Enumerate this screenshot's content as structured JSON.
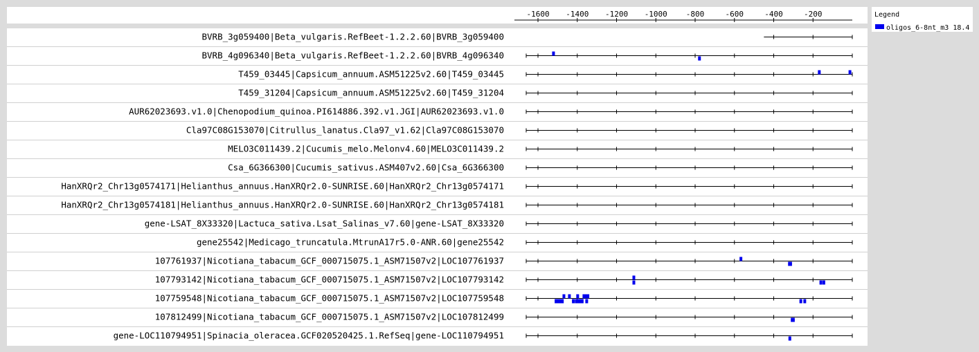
{
  "chart_data": {
    "type": "scatter",
    "xlim": [
      -1660,
      0
    ],
    "x_ticks": [
      -1600,
      -1400,
      -1200,
      -1000,
      -800,
      -600,
      -400,
      -200
    ],
    "legend": {
      "title": "Legend",
      "entries": [
        {
          "label": "oligos_6-8nt_m3 18.4",
          "color": "#0000ee"
        }
      ]
    },
    "rows": [
      {
        "label": "BVRB_3g059400|Beta_vulgaris.RefBeet-1.2.2.60|BVRB_3g059400",
        "start": -450,
        "marks": []
      },
      {
        "label": "BVRB_4g096340|Beta_vulgaris.RefBeet-1.2.2.60|BVRB_4g096340",
        "start": -1660,
        "marks": [
          {
            "x": -1521,
            "strand": "+"
          },
          {
            "x": -778,
            "strand": "-"
          }
        ]
      },
      {
        "label": "T459_03445|Capsicum_annuum.ASM51225v2.60|T459_03445",
        "start": -1660,
        "marks": [
          {
            "x": -168,
            "strand": "+"
          },
          {
            "x": -12,
            "strand": "+"
          }
        ]
      },
      {
        "label": "T459_31204|Capsicum_annuum.ASM51225v2.60|T459_31204",
        "start": -1660,
        "marks": []
      },
      {
        "label": "AUR62023693.v1.0|Chenopodium_quinoa.PI614886.392.v1.JGI|AUR62023693.v1.0",
        "start": -1660,
        "marks": []
      },
      {
        "label": "Cla97C08G153070|Citrullus_lanatus.Cla97_v1.62|Cla97C08G153070",
        "start": -1660,
        "marks": []
      },
      {
        "label": "MELO3C011439.2|Cucumis_melo.Melonv4.60|MELO3C011439.2",
        "start": -1660,
        "marks": []
      },
      {
        "label": "Csa_6G366300|Cucumis_sativus.ASM407v2.60|Csa_6G366300",
        "start": -1660,
        "marks": []
      },
      {
        "label": "HanXRQr2_Chr13g0574171|Helianthus_annuus.HanXRQr2.0-SUNRISE.60|HanXRQr2_Chr13g0574171",
        "start": -1660,
        "marks": []
      },
      {
        "label": "HanXRQr2_Chr13g0574181|Helianthus_annuus.HanXRQr2.0-SUNRISE.60|HanXRQr2_Chr13g0574181",
        "start": -1660,
        "marks": []
      },
      {
        "label": "gene-LSAT_8X33320|Lactuca_sativa.Lsat_Salinas_v7.60|gene-LSAT_8X33320",
        "start": -1660,
        "marks": []
      },
      {
        "label": "gene25542|Medicago_truncatula.MtrunA17r5.0-ANR.60|gene25542",
        "start": -1660,
        "marks": []
      },
      {
        "label": "107761937|Nicotiana_tabacum_GCF_000715075.1_ASM71507v2|LOC107761937",
        "start": -1660,
        "marks": [
          {
            "x": -567,
            "strand": "+"
          },
          {
            "x": -320,
            "strand": "-"
          },
          {
            "x": -314,
            "strand": "-"
          }
        ]
      },
      {
        "label": "107793142|Nicotiana_tabacum_GCF_000715075.1_ASM71507v2|LOC107793142",
        "start": -1660,
        "marks": [
          {
            "x": -1112,
            "strand": "+"
          },
          {
            "x": -1112,
            "strand": "-"
          },
          {
            "x": -160,
            "strand": "-"
          },
          {
            "x": -145,
            "strand": "-"
          }
        ]
      },
      {
        "label": "107759548|Nicotiana_tabacum_GCF_000715075.1_ASM71507v2|LOC107759548",
        "start": -1660,
        "marks": [
          {
            "x": -1508,
            "strand": "-"
          },
          {
            "x": -1496,
            "strand": "-"
          },
          {
            "x": -1486,
            "strand": "-"
          },
          {
            "x": -1476,
            "strand": "-"
          },
          {
            "x": -1468,
            "strand": "+"
          },
          {
            "x": -1440,
            "strand": "+"
          },
          {
            "x": -1420,
            "strand": "-"
          },
          {
            "x": -1405,
            "strand": "-"
          },
          {
            "x": -1398,
            "strand": "+"
          },
          {
            "x": -1392,
            "strand": "-"
          },
          {
            "x": -1384,
            "strand": "-"
          },
          {
            "x": -1375,
            "strand": "-"
          },
          {
            "x": -1366,
            "strand": "+"
          },
          {
            "x": -1358,
            "strand": "+"
          },
          {
            "x": -1352,
            "strand": "-"
          },
          {
            "x": -1346,
            "strand": "+"
          },
          {
            "x": -262,
            "strand": "-"
          },
          {
            "x": -242,
            "strand": "-"
          }
        ]
      },
      {
        "label": "107812499|Nicotiana_tabacum_GCF_000715075.1_ASM71507v2|LOC107812499",
        "start": -1660,
        "marks": [
          {
            "x": -306,
            "strand": "-"
          },
          {
            "x": -300,
            "strand": "-"
          }
        ]
      },
      {
        "label": "gene-LOC110794951|Spinacia_oleracea.GCF020520425.1.RefSeq|gene-LOC110794951",
        "start": -1660,
        "marks": [
          {
            "x": -318,
            "strand": "-"
          }
        ]
      }
    ]
  }
}
